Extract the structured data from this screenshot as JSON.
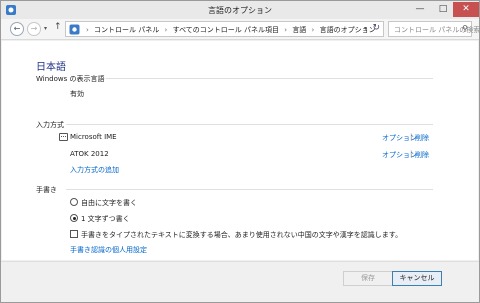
{
  "window": {
    "title": "言語のオプション",
    "controls": {
      "minimize": "—",
      "maximize": "□",
      "close": "✕"
    }
  },
  "nav": {
    "back_icon": "←",
    "forward_icon": "→",
    "dropdown_icon": "▾",
    "up_icon": "↑",
    "breadcrumbs": [
      "コントロール パネル",
      "すべてのコントロール パネル項目",
      "言語",
      "言語のオプション"
    ],
    "breadcrumb_separator": "›",
    "address_dropdown_icon": "▾",
    "refresh_icon": "↻",
    "search_placeholder": "コントロール パネルの検索",
    "search_icon": "⚲"
  },
  "content": {
    "language_heading": "日本語",
    "display_language": {
      "title": "Windows の表示言語",
      "status": "有効"
    },
    "input_methods": {
      "title": "入力方式",
      "items": [
        {
          "name": "Microsoft IME",
          "options_link": "オプション",
          "separator": "|",
          "remove_link": "削除"
        },
        {
          "name": "ATOK 2012",
          "options_link": "オプション",
          "separator": "|",
          "remove_link": "削除"
        }
      ],
      "add_link": "入力方式の追加"
    },
    "handwriting": {
      "title": "手書き",
      "radio_free": "自由に文字を書く",
      "radio_single": "1 文字ずつ書く",
      "selected": "radio_single",
      "checkbox_label": "手書きをタイプされたテキストに変換する場合、あまり使用されない中国の文字や漢字を認識します。",
      "checkbox_checked": false,
      "personalize_link": "手書き認識の個人用設定"
    }
  },
  "footer": {
    "save_label": "保存",
    "cancel_label": "キャンセル"
  },
  "colors": {
    "link": "#0066cc",
    "heading": "#1e3287",
    "close_button": "#c75050"
  }
}
